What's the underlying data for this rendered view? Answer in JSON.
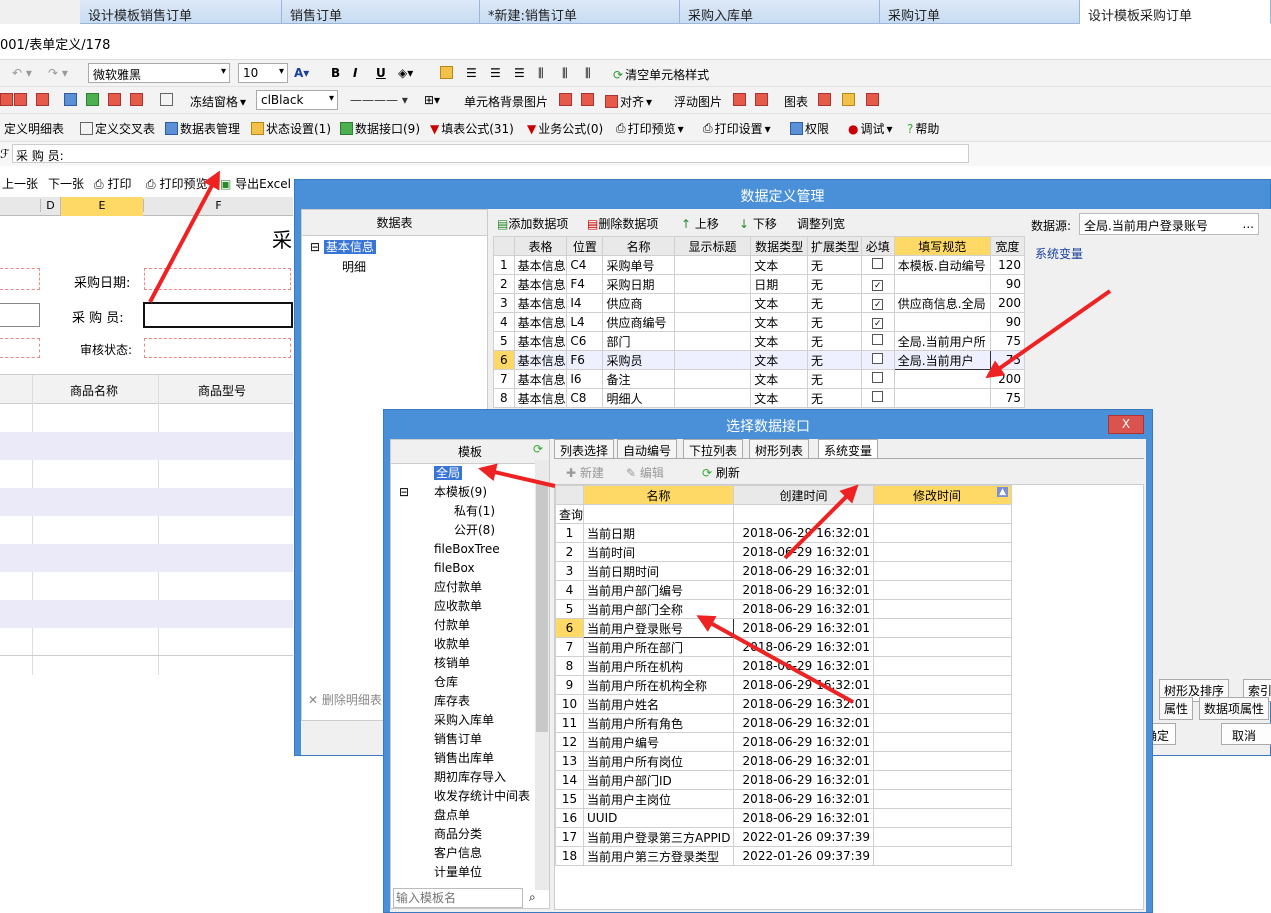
{
  "tabs": [
    "设计模板销售订单",
    "销售订单",
    "*新建:销售订单",
    "采购入库单",
    "采购订单",
    "设计模板采购订单"
  ],
  "path": "001/表单定义/178",
  "toolbar1": {
    "font": "微软雅黑",
    "size": "10",
    "clear": "清空单元格样式"
  },
  "toolbar2": {
    "freeze": "冻结窗格",
    "color": "clBlack",
    "cellbg": "单元格背景图片",
    "align": "对齐",
    "float": "浮动图片",
    "chart": "图表"
  },
  "toolbar3": [
    "定义明细表",
    "定义交叉表",
    "数据表管理",
    "状态设置(1)",
    "数据接口(9)",
    "填表公式(31)",
    "业务公式(0)",
    "打印预览",
    "打印设置",
    "权限",
    "调试",
    "帮助"
  ],
  "formula_bar": {
    "label": "采 购 员:"
  },
  "nav_toolbar": [
    "上一张",
    "下一张",
    "打印",
    "打印预览",
    "导出Excel"
  ],
  "sheet": {
    "cols": [
      "D",
      "E",
      "F"
    ],
    "title_char": "采",
    "labels": [
      "采购日期:",
      "采 购 员:",
      "审核状态:"
    ],
    "detail_headers": [
      "商品名称",
      "商品型号"
    ]
  },
  "dlg1": {
    "title": "数据定义管理",
    "left_header": "数据表",
    "tree": [
      "基本信息",
      "明细"
    ],
    "toolbar": [
      "添加数据项",
      "删除数据项",
      "上移",
      "下移",
      "调整列宽"
    ],
    "headers": [
      "",
      "表格",
      "位置",
      "名称",
      "显示标题",
      "数据类型",
      "扩展类型",
      "必填",
      "填写规范",
      "宽度"
    ],
    "rows": [
      [
        "1",
        "基本信息",
        "C4",
        "采购单号",
        "",
        "文本",
        "无",
        "0",
        "本模板.自动编号",
        "120"
      ],
      [
        "2",
        "基本信息",
        "F4",
        "采购日期",
        "",
        "日期",
        "无",
        "1",
        "",
        "90"
      ],
      [
        "3",
        "基本信息",
        "I4",
        "供应商",
        "",
        "文本",
        "无",
        "1",
        "供应商信息.全局",
        "200"
      ],
      [
        "4",
        "基本信息",
        "L4",
        "供应商编号",
        "",
        "文本",
        "无",
        "1",
        "",
        "90"
      ],
      [
        "5",
        "基本信息",
        "C6",
        "部门",
        "",
        "文本",
        "无",
        "0",
        "全局.当前用户所",
        "75"
      ],
      [
        "6",
        "基本信息",
        "F6",
        "采购员",
        "",
        "文本",
        "无",
        "0",
        "全局.当前用户",
        "75"
      ],
      [
        "7",
        "基本信息",
        "I6",
        "备注",
        "",
        "文本",
        "无",
        "0",
        "",
        "200"
      ],
      [
        "8",
        "基本信息",
        "C8",
        "明细人",
        "",
        "文本",
        "无",
        "0",
        "",
        "75"
      ]
    ],
    "datasource_label": "数据源:",
    "datasource_value": "全局.当前用户登录账号",
    "sysvar": "系统变量",
    "delete_detail": "删除明细表",
    "right_tabs": [
      "树形及排序",
      "索引",
      "属性",
      "数据项属性"
    ],
    "ok": "确定",
    "cancel": "取消"
  },
  "dlg2": {
    "title": "选择数据接口",
    "close": "X",
    "left_header": "模板",
    "tree": [
      "全局",
      "本模板(9)",
      "私有(1)",
      "公开(8)",
      "fileBoxTree",
      "fileBox",
      "应付款单",
      "应收款单",
      "付款单",
      "收款单",
      "核销单",
      "仓库",
      "库存表",
      "采购入库单",
      "销售订单",
      "销售出库单",
      "期初库存导入",
      "收发存统计中间表",
      "盘点单",
      "商品分类",
      "客户信息",
      "计量单位"
    ],
    "search_placeholder": "输入模板名",
    "tabs": [
      "列表选择",
      "自动编号",
      "下拉列表",
      "树形列表",
      "系统变量"
    ],
    "toolbar": [
      "新建",
      "编辑",
      "刷新"
    ],
    "headers": [
      "名称",
      "创建时间",
      "修改时间"
    ],
    "query": "查询",
    "rows": [
      [
        "1",
        "当前日期",
        "2018-06-29 16:32:01"
      ],
      [
        "2",
        "当前时间",
        "2018-06-29 16:32:01"
      ],
      [
        "3",
        "当前日期时间",
        "2018-06-29 16:32:01"
      ],
      [
        "4",
        "当前用户部门编号",
        "2018-06-29 16:32:01"
      ],
      [
        "5",
        "当前用户部门全称",
        "2018-06-29 16:32:01"
      ],
      [
        "6",
        "当前用户登录账号",
        "2018-06-29 16:32:01"
      ],
      [
        "7",
        "当前用户所在部门",
        "2018-06-29 16:32:01"
      ],
      [
        "8",
        "当前用户所在机构",
        "2018-06-29 16:32:01"
      ],
      [
        "9",
        "当前用户所在机构全称",
        "2018-06-29 16:32:01"
      ],
      [
        "10",
        "当前用户姓名",
        "2018-06-29 16:32:01"
      ],
      [
        "11",
        "当前用户所有角色",
        "2018-06-29 16:32:01"
      ],
      [
        "12",
        "当前用户编号",
        "2018-06-29 16:32:01"
      ],
      [
        "13",
        "当前用户所有岗位",
        "2018-06-29 16:32:01"
      ],
      [
        "14",
        "当前用户部门ID",
        "2018-06-29 16:32:01"
      ],
      [
        "15",
        "当前用户主岗位",
        "2018-06-29 16:32:01"
      ],
      [
        "16",
        "UUID",
        "2018-06-29 16:32:01"
      ],
      [
        "17",
        "当前用户登录第三方APPID",
        "2022-01-26 09:37:39"
      ],
      [
        "18",
        "当前用户第三方登录类型",
        "2022-01-26 09:37:39"
      ]
    ]
  },
  "colors": {
    "titlebar": "#4a90d9",
    "highlight": "#ffd966",
    "arrow": "#ee2222",
    "selected": "#3875d7"
  }
}
